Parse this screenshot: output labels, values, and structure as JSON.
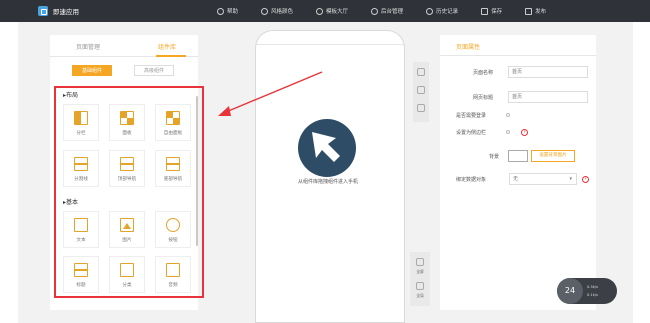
{
  "app": {
    "name": "即速应用"
  },
  "topnav": [
    {
      "label": "帮助",
      "icon": "help-icon"
    },
    {
      "label": "风格颜色",
      "icon": "palette-icon"
    },
    {
      "label": "模板大厅",
      "icon": "star-icon"
    },
    {
      "label": "后台管理",
      "icon": "gear-icon"
    },
    {
      "label": "历史记录",
      "icon": "history-icon"
    },
    {
      "label": "保存",
      "icon": "save-icon"
    },
    {
      "label": "发布",
      "icon": "publish-icon"
    }
  ],
  "left_panel": {
    "tabs": [
      "页面管理",
      "组件库"
    ],
    "active_tab": "组件库",
    "subtabs": [
      "基础组件",
      "高级组件"
    ],
    "sections": [
      {
        "title": "布局",
        "items": [
          "分栏",
          "面板",
          "自由面板",
          "分割线",
          "顶部导航",
          "底部导航"
        ]
      },
      {
        "title": "基本",
        "items": [
          "文本",
          "图片",
          "按钮",
          "标题",
          "分类",
          "音频"
        ]
      }
    ]
  },
  "canvas": {
    "drop_hint": "从组件库拖拽组件进入手机"
  },
  "side_tools": {
    "labels": [
      "全屏",
      "全局"
    ]
  },
  "right_panel": {
    "title": "页面属性",
    "fields": [
      {
        "label": "页面名称",
        "value": "首页"
      },
      {
        "label": "网页标题",
        "value": "首页"
      }
    ],
    "checks": [
      "是否需要登录",
      "设置为侧边栏"
    ],
    "background_label": "背景",
    "color_button": "设置背景图片",
    "share_label": "绑定数据对象",
    "share_value": "无"
  },
  "bubble": {
    "value": "24",
    "line1": "0.3k/s",
    "line2": "0.1k/s"
  },
  "colors": {
    "accent": "#f5a623",
    "highlight": "#e8333a",
    "topbar": "#2f3238"
  }
}
